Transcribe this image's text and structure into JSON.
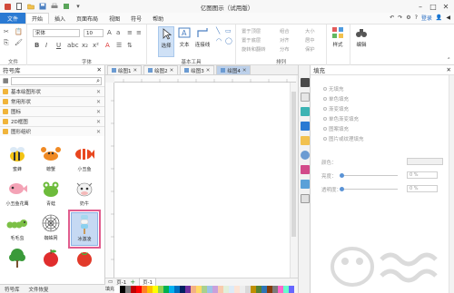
{
  "window": {
    "title": "亿图图示（试用版）"
  },
  "menubar": {
    "file_label": "文件",
    "items": [
      "开始",
      "插入",
      "页面布局",
      "视图",
      "符号",
      "帮助"
    ],
    "login_label": "登录"
  },
  "ribbon": {
    "font_name": "宋体",
    "font_size": "10",
    "groups": {
      "file": "文件",
      "font": "字体",
      "basic_tools": "基本工具",
      "arrange": "排列"
    },
    "tools": {
      "select": "选择",
      "text": "文本",
      "connector": "连接线"
    },
    "arrange_items": [
      "置于顶层",
      "置于底层",
      "旋转和翻转",
      "组合",
      "对齐",
      "分布",
      "大小",
      "居中",
      "保护"
    ],
    "style_label": "样式",
    "edit_label": "编辑"
  },
  "left_panel": {
    "title": "符号库",
    "libraries": [
      "基本绘图形状",
      "常用形状",
      "图标",
      "2D框图",
      "图形组织"
    ],
    "symbols": [
      "蜜蜂",
      "螃蟹",
      "小丑鱼",
      "小丑鱼花鹰",
      "青蛙",
      "奶牛",
      "毛毛虫",
      "蜘蛛网",
      "冰激凌",
      "",
      "",
      ""
    ],
    "bottom_tabs": [
      "符号库",
      "文件恢复"
    ]
  },
  "doc_tabs": [
    "绘图1",
    "绘图2",
    "绘图3",
    "绘图4"
  ],
  "page_bar": {
    "page_label": "页-1",
    "page_tab": "页-1",
    "add_label": "+"
  },
  "color_bar_label": "填充",
  "right_panel": {
    "title": "填充",
    "fill_options": [
      "无填充",
      "单色填充",
      "渐变填充",
      "单色渐变填充",
      "图案填充",
      "图片或纹理填充"
    ],
    "color_label": "颜色：",
    "brightness_label": "亮度：",
    "transparency_label": "透明度：",
    "brightness_value": "0 %",
    "transparency_value": "0 %",
    "brightness": 0.0,
    "transparency": 0.0
  },
  "colors": {
    "accent": "#2a7ad3",
    "selection_frame": "#e05d8e",
    "selected_symbol_bg": "#c6d9f3"
  }
}
